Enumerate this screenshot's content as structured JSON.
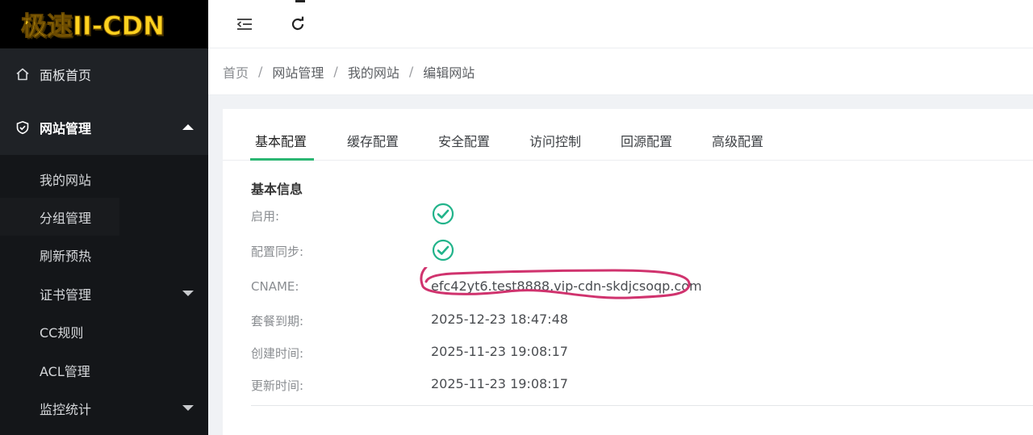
{
  "logo": {
    "text": "极速II-CDN"
  },
  "sidebar": {
    "home": {
      "label": "面板首页",
      "icon": "home-icon"
    },
    "site": {
      "label": "网站管理",
      "icon": "shield-icon",
      "expanded": true
    },
    "items": [
      {
        "label": "我的网站"
      },
      {
        "label": "分组管理"
      },
      {
        "label": "刷新预热"
      },
      {
        "label": "证书管理",
        "has_children": true
      },
      {
        "label": "CC规则"
      },
      {
        "label": "ACL管理"
      },
      {
        "label": "监控统计",
        "has_children": true
      }
    ]
  },
  "topbar": {
    "collapse_icon": "menu-fold-icon",
    "refresh_icon": "refresh-icon"
  },
  "breadcrumb": {
    "items": [
      "首页",
      "网站管理",
      "我的网站",
      "编辑网站"
    ],
    "separator": "/"
  },
  "tabs": [
    "基本配置",
    "缓存配置",
    "安全配置",
    "访问控制",
    "回源配置",
    "高级配置"
  ],
  "active_tab": "基本配置",
  "section": {
    "title": "基本信息",
    "enabled": {
      "label": "启用:",
      "checked": true
    },
    "sync": {
      "label": "配置同步:",
      "checked": true
    },
    "cname": {
      "label": "CNAME:",
      "value": "efc42yt6.test8888.vip-cdn-skdjcsoqp.com"
    },
    "expire": {
      "label": "套餐到期:",
      "value": "2025-12-23 18:47:48"
    },
    "created": {
      "label": "创建时间:",
      "value": "2025-11-23 19:08:17"
    },
    "updated": {
      "label": "更新时间:",
      "value": "2025-11-23 19:08:17"
    }
  },
  "colors": {
    "accent": "#2bb673",
    "check": "#21b38a",
    "annotation": "#d0336e",
    "sidebar_bg": "#1f2226",
    "logo": "#ffd21f"
  }
}
